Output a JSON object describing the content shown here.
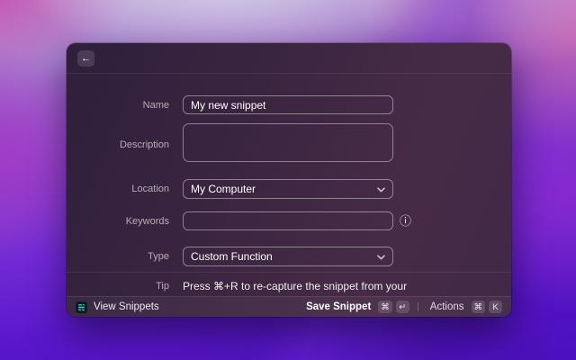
{
  "colors": {
    "accent_teal": "#2fd9c4",
    "window_bg": "#3a2540",
    "wallpaper_magenta": "#cb3aa6",
    "wallpaper_violet": "#4a10ba",
    "field_border": "rgba(255,255,255,0.42)"
  },
  "icons": {
    "back": "←",
    "info": "ⓘ",
    "chevron_down": "⌄",
    "snippets": "snippets-list-icon"
  },
  "window": {
    "form": {
      "name": {
        "label": "Name",
        "value": "My new snippet"
      },
      "description": {
        "label": "Description",
        "value": ""
      },
      "location": {
        "label": "Location",
        "value": "My Computer"
      },
      "keywords": {
        "label": "Keywords",
        "value": ""
      },
      "type": {
        "label": "Type",
        "value": "Custom Function"
      },
      "tip": {
        "label": "Tip",
        "text": "Press ⌘+R to re-capture the snippet from your"
      }
    },
    "footer": {
      "view_snippets_label": "View Snippets",
      "save_snippet_label": "Save Snippet",
      "save_keys": [
        "⌘",
        "↵"
      ],
      "actions_label": "Actions",
      "actions_keys": [
        "⌘",
        "K"
      ]
    }
  }
}
